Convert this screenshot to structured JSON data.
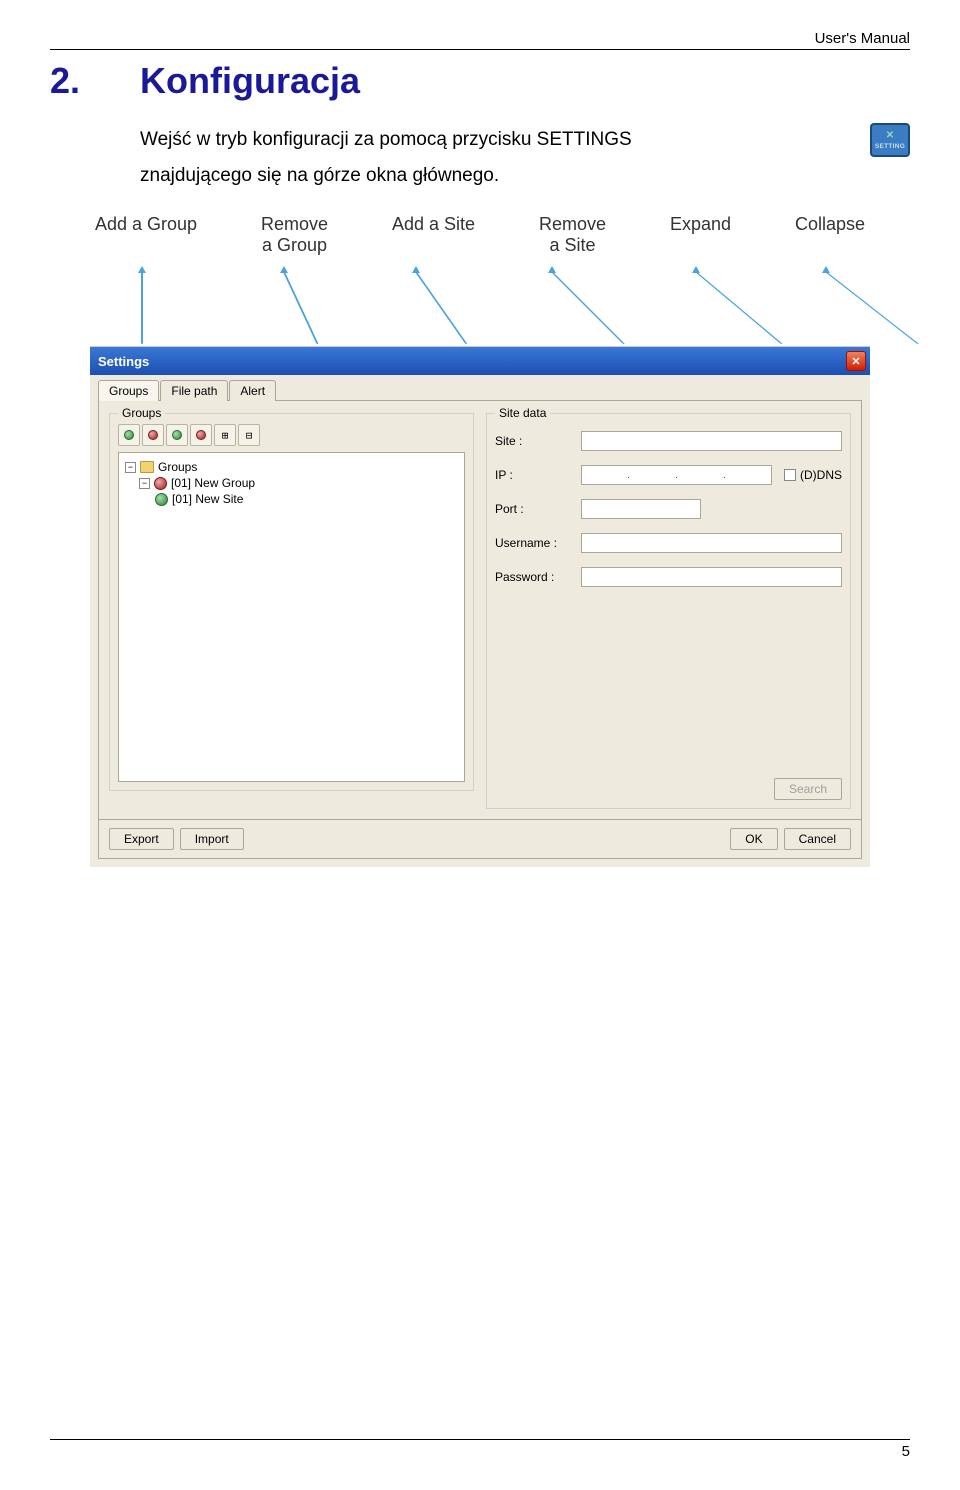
{
  "header": {
    "right": "User's Manual"
  },
  "section": {
    "number": "2.",
    "title": "Konfiguracja"
  },
  "body": {
    "line1_a": "Wejść  w  tryb  konfiguracji  za  pomocą  przycisku  SETTINGS",
    "line2": "znajdującego się na górze okna głównego."
  },
  "callouts": {
    "add_group": "Add a Group",
    "remove_group_l1": "Remove",
    "remove_group_l2": "a Group",
    "add_site": "Add a Site",
    "remove_site_l1": "Remove",
    "remove_site_l2": "a Site",
    "expand": "Expand",
    "collapse": "Collapse"
  },
  "window": {
    "title": "Settings",
    "tabs": {
      "groups": "Groups",
      "filepath": "File path",
      "alert": "Alert"
    },
    "left": {
      "fieldset_title": "Groups",
      "tree_root": "Groups",
      "tree_group": "[01] New Group",
      "tree_site": "[01] New Site"
    },
    "right": {
      "fieldset_title": "Site data",
      "site_label": "Site :",
      "ip_label": "IP :",
      "port_label": "Port :",
      "username_label": "Username :",
      "password_label": "Password :",
      "dns_label": "(D)DNS",
      "search_btn": "Search"
    },
    "bottom": {
      "export": "Export",
      "import": "Import",
      "ok": "OK",
      "cancel": "Cancel"
    }
  },
  "footer": {
    "page": "5"
  }
}
